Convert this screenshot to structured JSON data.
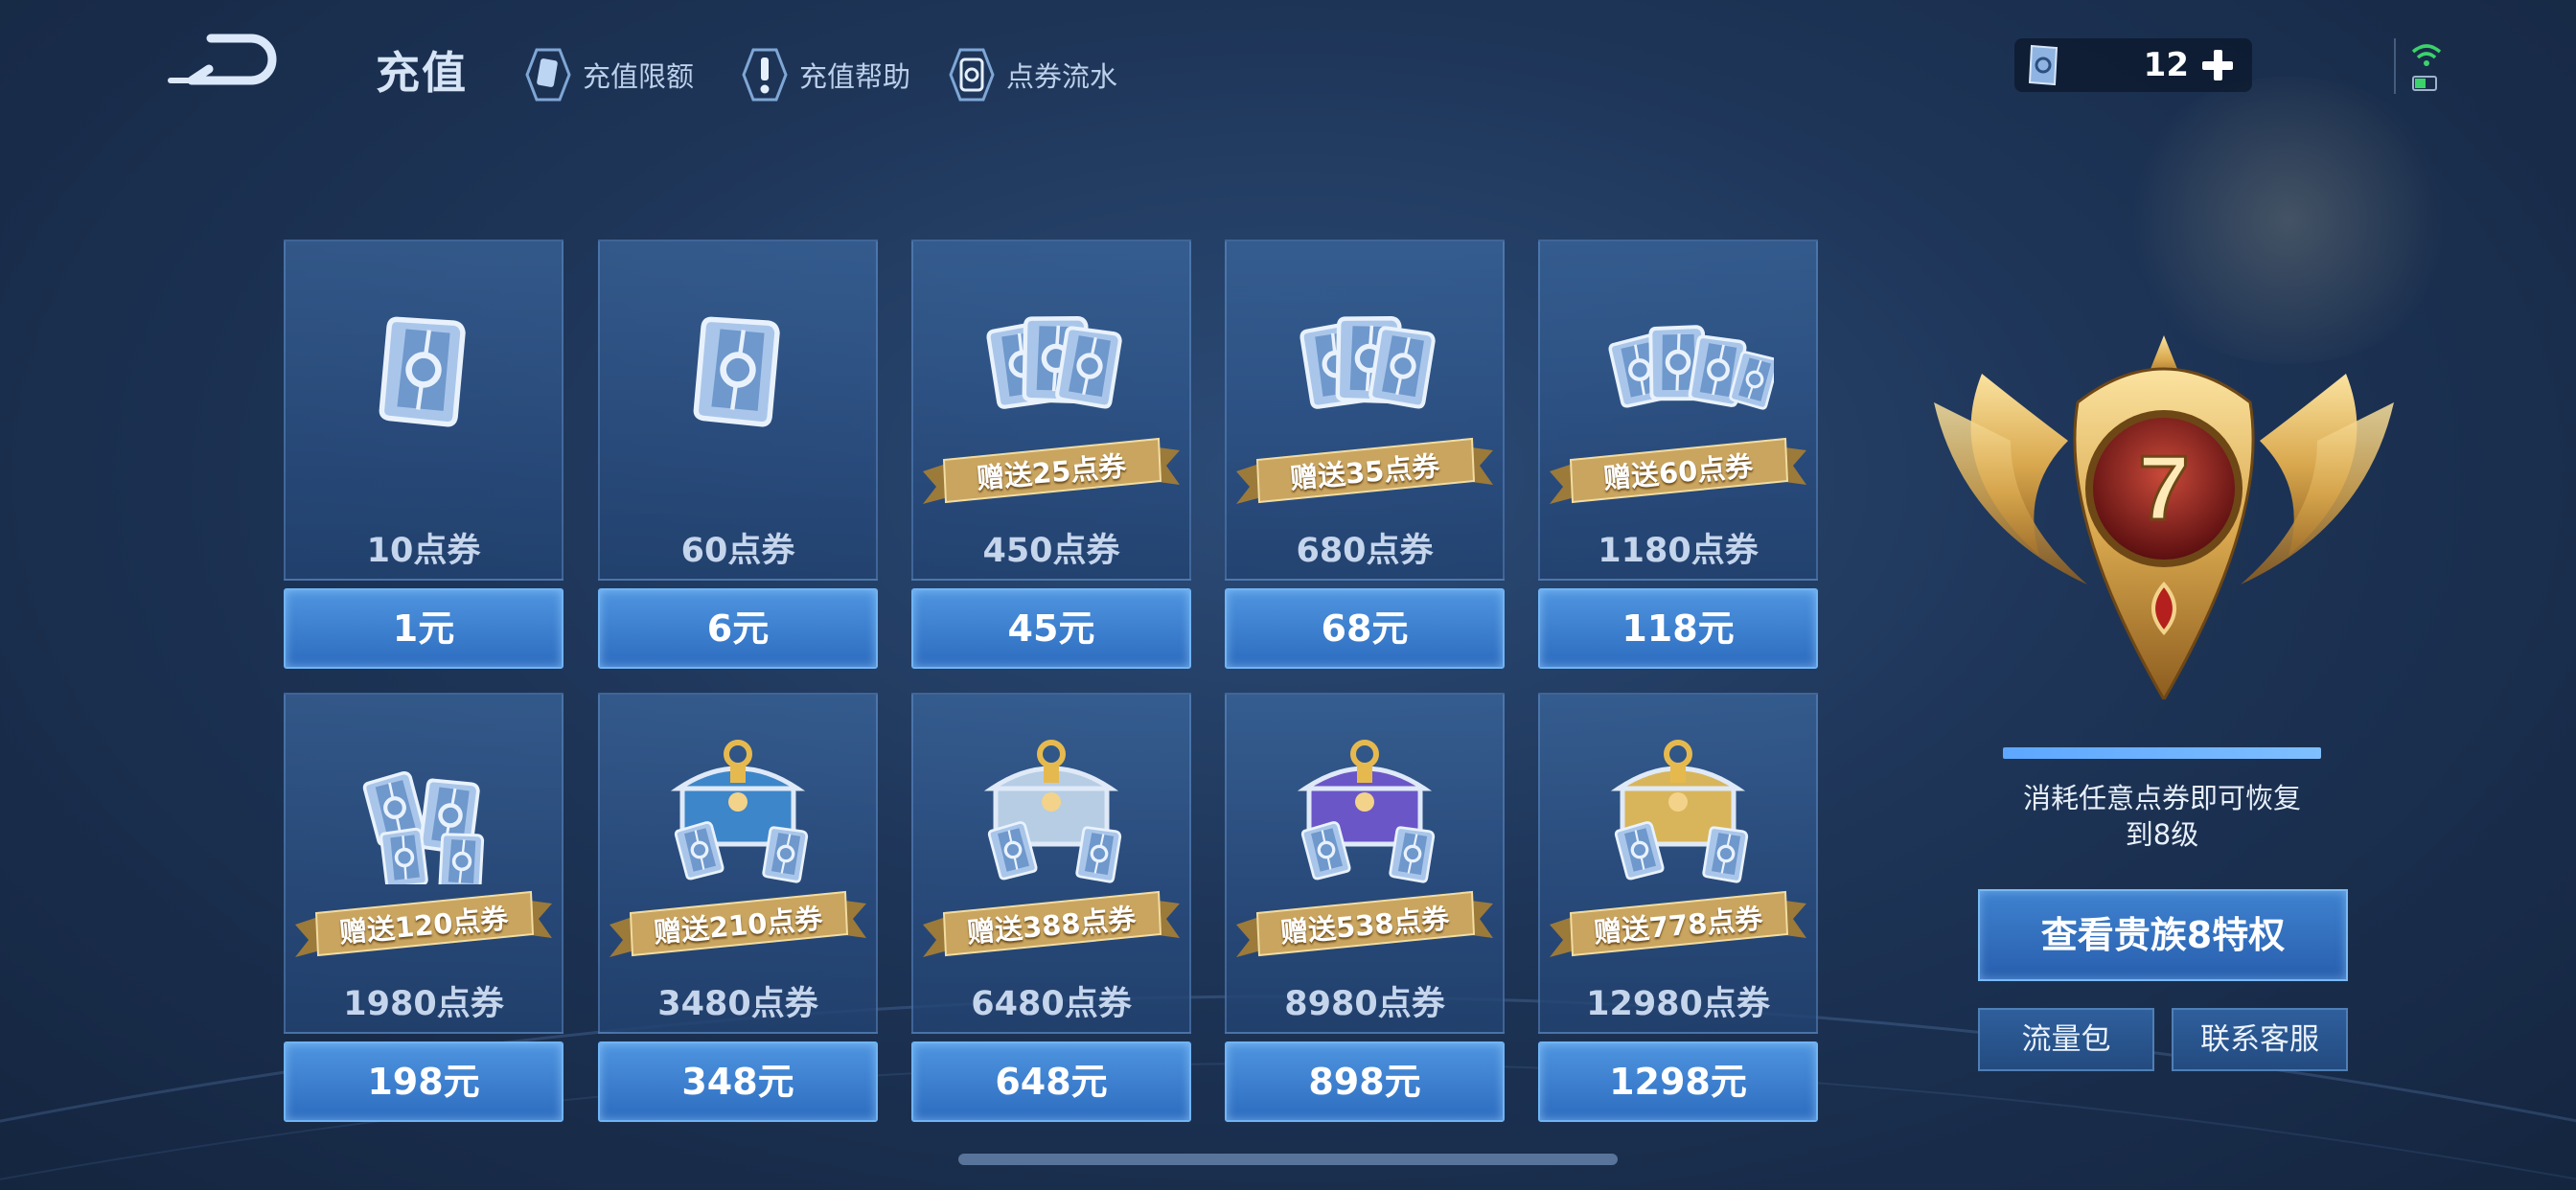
{
  "header": {
    "title": "充值",
    "links": [
      {
        "label": "充值限额",
        "icon": "card-icon"
      },
      {
        "label": "充值帮助",
        "icon": "exclamation-icon"
      },
      {
        "label": "点券流水",
        "icon": "ticket-flow-icon"
      }
    ],
    "balance": "12"
  },
  "packages": [
    {
      "qty": "10点券",
      "price": "1元",
      "bonus": "",
      "art": "single-ticket"
    },
    {
      "qty": "60点券",
      "price": "6元",
      "bonus": "",
      "art": "single-ticket"
    },
    {
      "qty": "450点券",
      "price": "45元",
      "bonus": "赠送25点券",
      "art": "ticket-fan"
    },
    {
      "qty": "680点券",
      "price": "68元",
      "bonus": "赠送35点券",
      "art": "ticket-fan"
    },
    {
      "qty": "1180点券",
      "price": "118元",
      "bonus": "赠送60点券",
      "art": "ticket-pile"
    },
    {
      "qty": "1980点券",
      "price": "198元",
      "bonus": "赠送120点券",
      "art": "ticket-stack"
    },
    {
      "qty": "3480点券",
      "price": "348元",
      "bonus": "赠送210点券",
      "art": "chest-blue"
    },
    {
      "qty": "6480点券",
      "price": "648元",
      "bonus": "赠送388点券",
      "art": "chest-silver"
    },
    {
      "qty": "8980点券",
      "price": "898元",
      "bonus": "赠送538点券",
      "art": "chest-purple"
    },
    {
      "qty": "12980点券",
      "price": "1298元",
      "bonus": "赠送778点券",
      "art": "chest-gold"
    }
  ],
  "vip": {
    "level": "7",
    "progress": 1.0,
    "message_line1": "消耗任意点券即可恢复",
    "message_line2": "到8级",
    "privilege_button": "查看贵族8特权",
    "data_pack_button": "流量包",
    "support_button": "联系客服"
  },
  "colors": {
    "background": "#1e3558",
    "price_button": "#2d6cbf",
    "ribbon_gold": "#c9a560",
    "emblem_gold": "#e0b866",
    "emblem_red": "#8a1f1c"
  }
}
